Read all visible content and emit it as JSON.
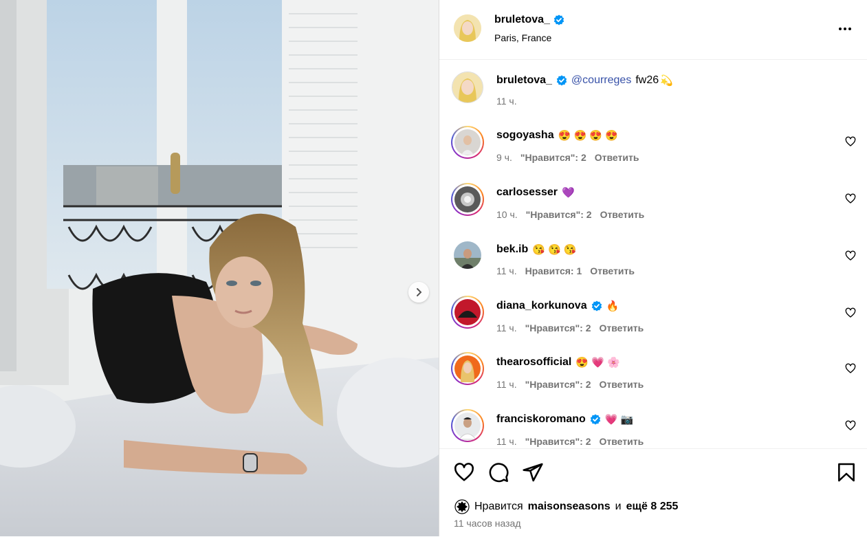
{
  "post": {
    "author": "bruletova_",
    "location": "Paris, France",
    "caption_mention": "@courreges",
    "caption_text": "fw26",
    "caption_emoji": "💫",
    "caption_time": "11 ч."
  },
  "comments": [
    {
      "user": "sogoyasha",
      "verified": false,
      "text": "😍 😍 😍 😍",
      "time": "9 ч.",
      "likes": "\"Нравится\": 2",
      "reply": "Ответить"
    },
    {
      "user": "carlosesser",
      "verified": false,
      "text": "💜",
      "time": "10 ч.",
      "likes": "\"Нравится\": 2",
      "reply": "Ответить"
    },
    {
      "user": "bek.ib",
      "verified": false,
      "text": "😘 😘 😘",
      "time": "11 ч.",
      "likes": "Нравится: 1",
      "reply": "Ответить"
    },
    {
      "user": "diana_korkunova",
      "verified": true,
      "text": "🔥",
      "time": "11 ч.",
      "likes": "\"Нравится\": 2",
      "reply": "Ответить"
    },
    {
      "user": "thearosofficial",
      "verified": false,
      "text": "😍 💗 🌸",
      "time": "11 ч.",
      "likes": "\"Нравится\": 2",
      "reply": "Ответить"
    },
    {
      "user": "franciskoromano",
      "verified": true,
      "text": "💗 📷",
      "time": "11 ч.",
      "likes": "\"Нравится\": 2",
      "reply": "Ответить"
    }
  ],
  "likes": {
    "prefix": "Нравится",
    "user": "maisonseasons",
    "joiner": "и",
    "rest": "ещё 8 255"
  },
  "posted_ago": "11 часов назад",
  "colors": {
    "verified": "#0095f6",
    "mention": "#3751a8",
    "meta": "#737373"
  },
  "icons": [
    "more-options-icon",
    "verified-icon",
    "like-icon",
    "comment-icon",
    "share-icon",
    "save-icon",
    "next-arrow-icon"
  ]
}
